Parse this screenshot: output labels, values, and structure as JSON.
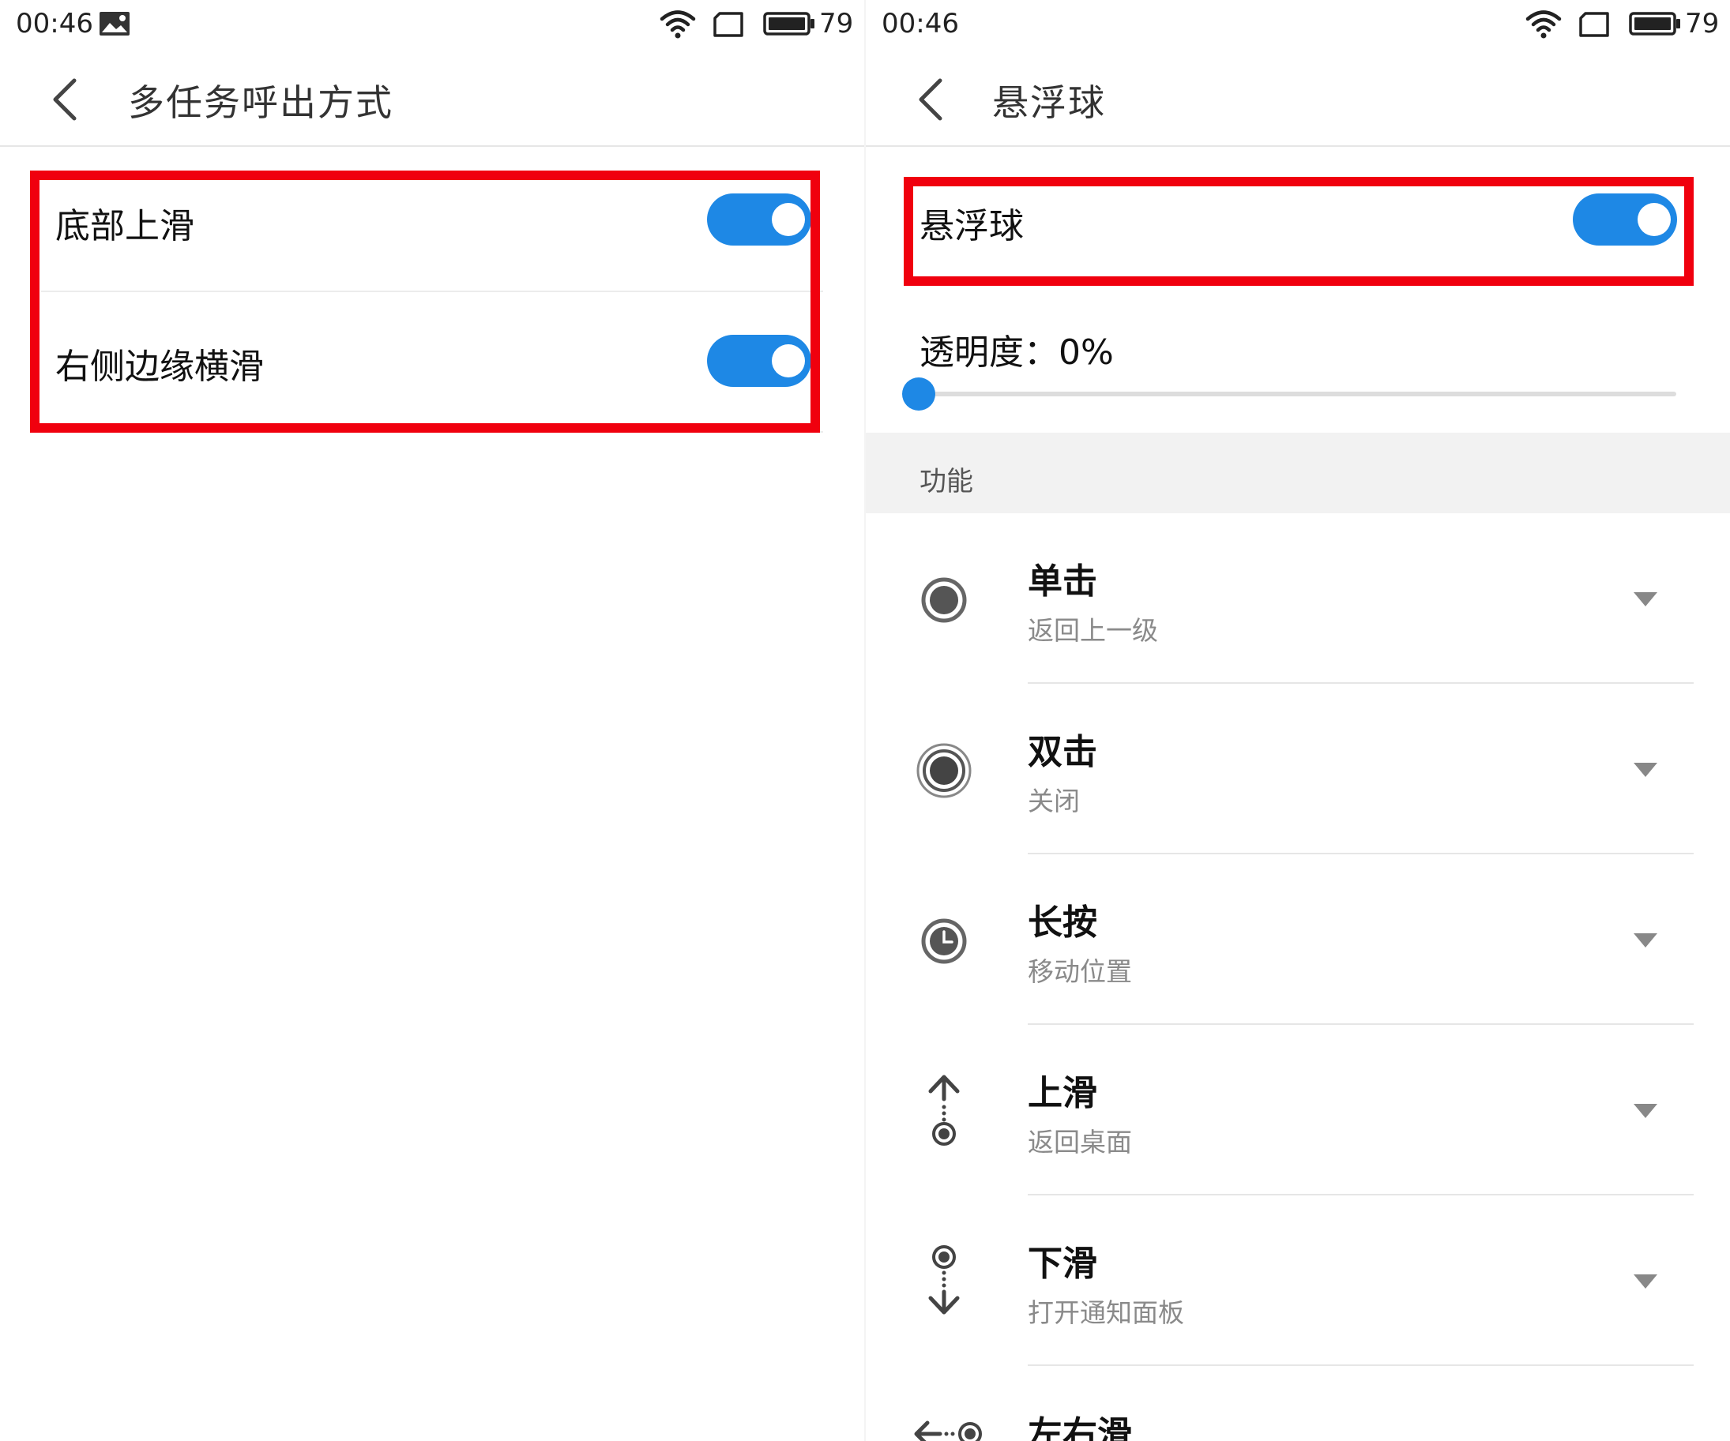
{
  "left": {
    "status": {
      "time": "00:46",
      "battery": "79"
    },
    "title": "多任务呼出方式",
    "settings": [
      {
        "label": "底部上滑",
        "enabled": true
      },
      {
        "label": "右侧边缘横滑",
        "enabled": true
      }
    ]
  },
  "right": {
    "status": {
      "time": "00:46",
      "battery": "79"
    },
    "title": "悬浮球",
    "main_toggle": {
      "label": "悬浮球",
      "enabled": true
    },
    "transparency": {
      "label": "透明度：0%",
      "value_percent": 0
    },
    "section_label": "功能",
    "actions": [
      {
        "title": "单击",
        "value": "返回上一级",
        "icon": "single-tap-icon"
      },
      {
        "title": "双击",
        "value": "关闭",
        "icon": "double-tap-icon"
      },
      {
        "title": "长按",
        "value": "移动位置",
        "icon": "long-press-clock-icon"
      },
      {
        "title": "上滑",
        "value": "返回桌面",
        "icon": "swipe-up-icon"
      },
      {
        "title": "下滑",
        "value": "打开通知面板",
        "icon": "swipe-down-icon"
      },
      {
        "title": "左右滑",
        "value": "",
        "icon": "swipe-horizontal-icon"
      }
    ]
  },
  "colors": {
    "accent": "#1e88e5",
    "highlight": "#f0000e",
    "section_bg": "#f2f2f2"
  }
}
